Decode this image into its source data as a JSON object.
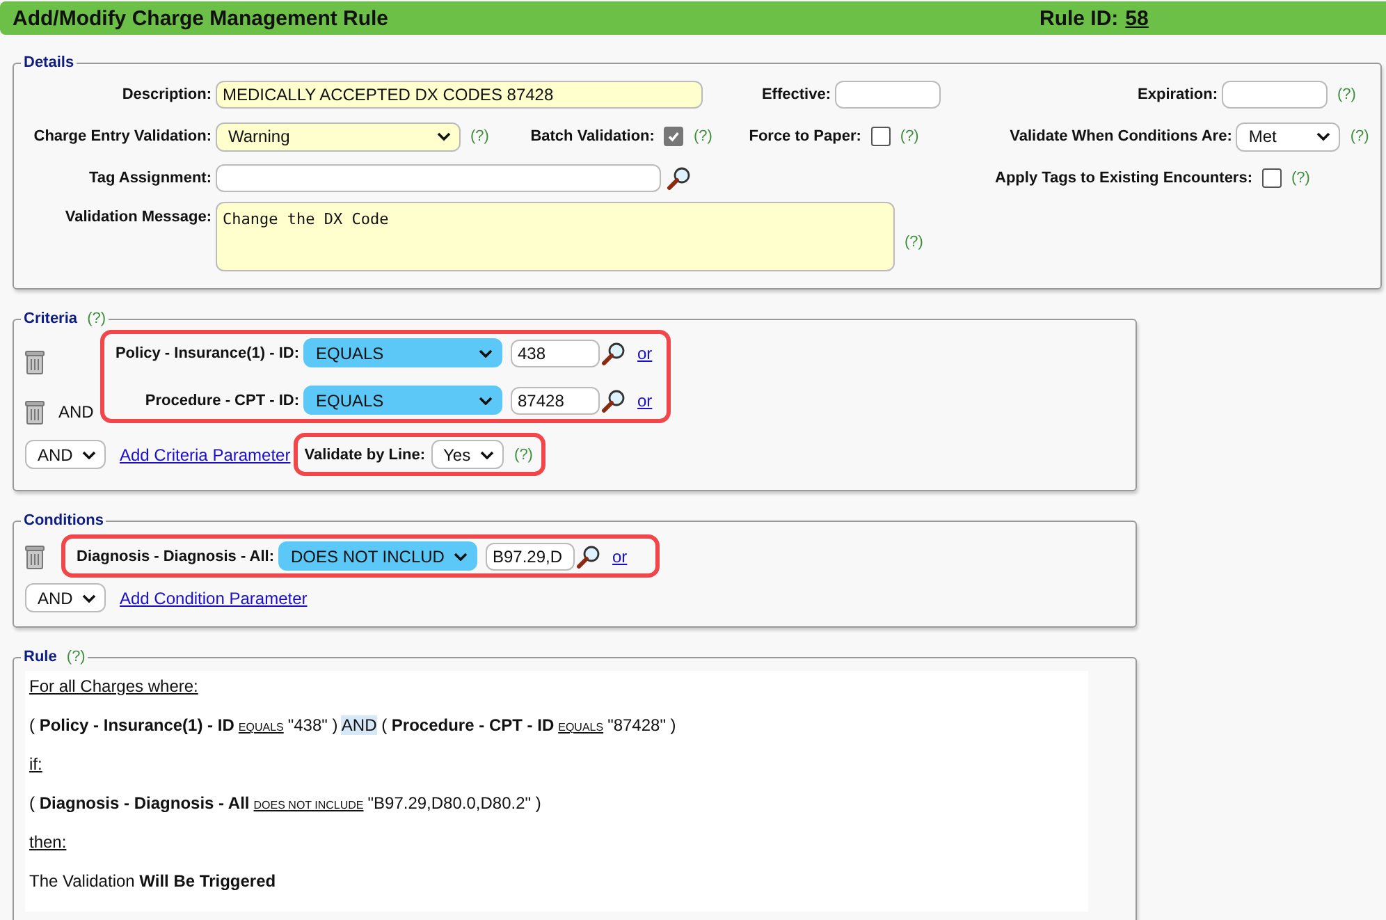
{
  "header": {
    "title": "Add/Modify Charge Management Rule",
    "rule_id_label": "Rule ID:",
    "rule_id": "58"
  },
  "details": {
    "legend": "Details",
    "description": {
      "label": "Description:",
      "value": "MEDICALLY ACCEPTED DX CODES 87428"
    },
    "effective": {
      "label": "Effective:"
    },
    "expiration": {
      "label": "Expiration:",
      "help": "(?)"
    },
    "charge_entry_validation": {
      "label": "Charge Entry Validation:",
      "value": "Warning",
      "help": "(?)"
    },
    "batch_validation": {
      "label": "Batch Validation:",
      "checked": true,
      "help": "(?)"
    },
    "force_to_paper": {
      "label": "Force to Paper:",
      "checked": false,
      "help": "(?)"
    },
    "validate_when": {
      "label": "Validate When Conditions Are:",
      "value": "Met",
      "help": "(?)"
    },
    "tag_assignment": {
      "label": "Tag Assignment:"
    },
    "apply_tags": {
      "label": "Apply Tags to Existing Encounters:",
      "checked": false,
      "help": "(?)"
    },
    "validation_message": {
      "label": "Validation Message:",
      "value": "Change the DX Code",
      "help": "(?)"
    }
  },
  "criteria": {
    "legend": "Criteria",
    "help": "(?)",
    "highlighted": true,
    "rows": [
      {
        "label": "Policy - Insurance(1) - ID:",
        "operator": "EQUALS",
        "value": "438",
        "link": "or"
      },
      {
        "connector": "AND",
        "label": "Procedure - CPT - ID:",
        "operator": "EQUALS",
        "value": "87428",
        "link": "or"
      }
    ],
    "joiner": "AND",
    "add_link": "Add Criteria Parameter",
    "validate_by_line": {
      "label": "Validate by Line:",
      "value": "Yes",
      "help": "(?)",
      "highlighted": true
    }
  },
  "conditions": {
    "legend": "Conditions",
    "highlighted": true,
    "rows": [
      {
        "label": "Diagnosis - Diagnosis - All:",
        "operator": "DOES NOT INCLUD",
        "value": "B97.29,D",
        "link": "or"
      }
    ],
    "joiner": "AND",
    "add_link": "Add Condition Parameter"
  },
  "rule": {
    "legend": "Rule",
    "help": "(?)",
    "lines": [
      [
        {
          "kind": "heading",
          "text": "For all Charges where:"
        }
      ],
      [
        {
          "kind": "plain",
          "text": "( "
        },
        {
          "kind": "bold",
          "text": "Policy - Insurance(1) - ID"
        },
        {
          "kind": "operator",
          "text": "EQUALS"
        },
        {
          "kind": "plain",
          "text": "\"438\" ) "
        },
        {
          "kind": "highlight",
          "text": "AND"
        },
        {
          "kind": "plain",
          "text": " ( "
        },
        {
          "kind": "bold",
          "text": "Procedure - CPT - ID"
        },
        {
          "kind": "operator",
          "text": "EQUALS"
        },
        {
          "kind": "plain",
          "text": "\"87428\" )"
        }
      ],
      [
        {
          "kind": "heading",
          "text": "if:"
        }
      ],
      [
        {
          "kind": "plain",
          "text": "( "
        },
        {
          "kind": "bold",
          "text": "Diagnosis - Diagnosis - All"
        },
        {
          "kind": "operator",
          "text": "DOES NOT INCLUDE"
        },
        {
          "kind": "plain",
          "text": "\"B97.29,D80.0,D80.2\" )"
        }
      ],
      [
        {
          "kind": "heading",
          "text": "then:"
        }
      ],
      [
        {
          "kind": "plain",
          "text": "The Validation "
        },
        {
          "kind": "bold",
          "text": "Will Be Triggered"
        }
      ]
    ]
  }
}
